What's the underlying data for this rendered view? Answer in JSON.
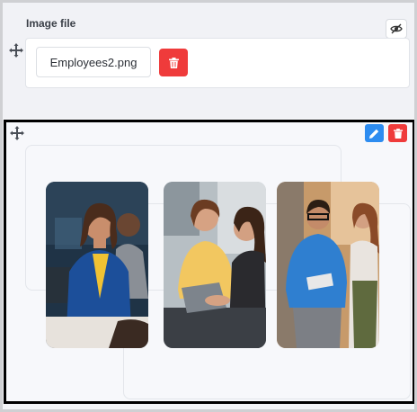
{
  "image_section": {
    "label": "Image file",
    "file_name": "Employees2.png"
  },
  "gallery": {
    "photos": [
      {
        "description_icon": "photo-woman-office-headset"
      },
      {
        "description_icon": "photo-two-women-laptop"
      },
      {
        "description_icon": "photo-man-woman-tablet"
      }
    ]
  },
  "colors": {
    "delete": "#ef3b3b",
    "edit": "#2d8cf0",
    "selection_border": "#000000"
  }
}
